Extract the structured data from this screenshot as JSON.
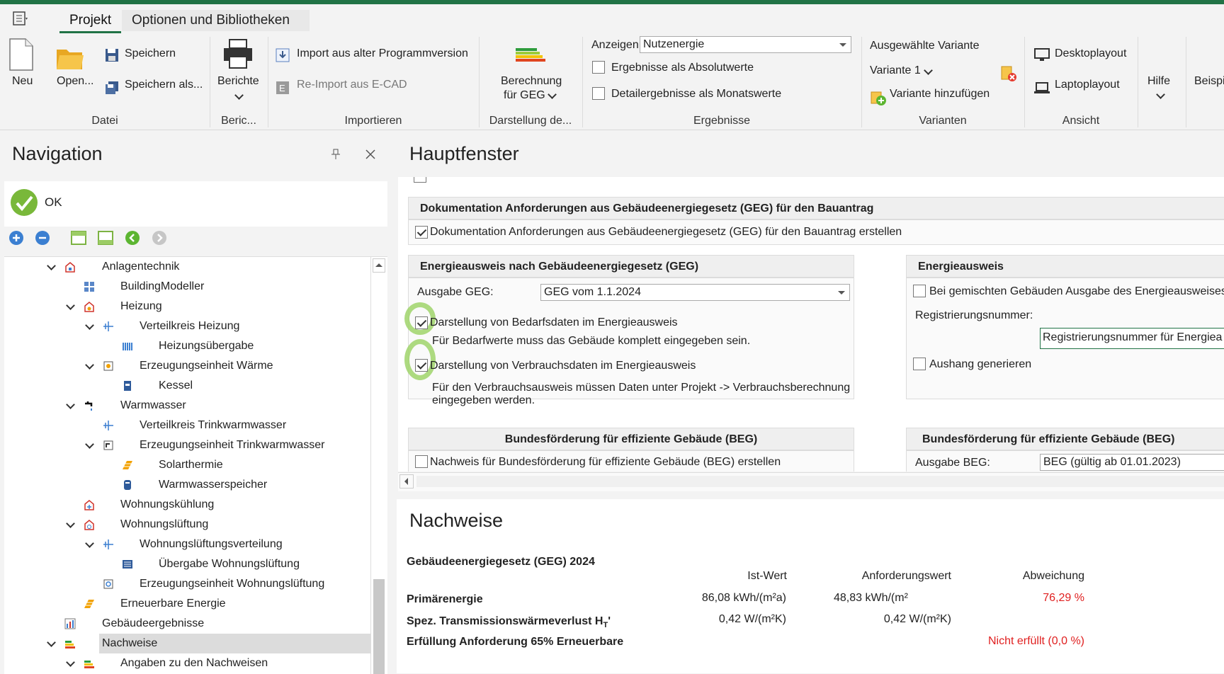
{
  "ribbon": {
    "tabs": [
      "Projekt",
      "Optionen und Bibliotheken"
    ],
    "datei": {
      "neu": "Neu",
      "open": "Open...",
      "speichern": "Speichern",
      "speichern_als": "Speichern als...",
      "group": "Datei"
    },
    "berichte": {
      "label": "Berichte",
      "group": "Beric..."
    },
    "importieren": {
      "import_alt": "Import aus alter Programmversion",
      "reimport": "Re-Import aus E-CAD",
      "group": "Importieren"
    },
    "darstellung": {
      "label1": "Berechnung",
      "label2": "für GEG",
      "group": "Darstellung de..."
    },
    "ergebnisse": {
      "anzeigen": "Anzeigen",
      "anzeigen_value": "Nutzenergie",
      "absolut": "Ergebnisse als Absolutwerte",
      "monats": "Detailergebnisse als Monatswerte",
      "group": "Ergebnisse"
    },
    "varianten": {
      "ausgewaehlt": "Ausgewählte Variante",
      "variante": "Variante 1",
      "hinzufuegen": "Variante hinzufügen",
      "group": "Varianten"
    },
    "ansicht": {
      "desktop": "Desktoplayout",
      "laptop": "Laptoplayout",
      "group": "Ansicht"
    },
    "hilfe": "Hilfe",
    "beispiel": "Beispi"
  },
  "navigation": {
    "title": "Navigation",
    "status": "OK",
    "tree": [
      {
        "label": "Anlagentechnik",
        "expanded": true
      },
      {
        "label": "BuildingModeller"
      },
      {
        "label": "Heizung",
        "expanded": true
      },
      {
        "label": "Verteilkreis Heizung",
        "expanded": true
      },
      {
        "label": "Heizungsübergabe"
      },
      {
        "label": "Erzeugungseinheit Wärme",
        "expanded": true
      },
      {
        "label": "Kessel"
      },
      {
        "label": "Warmwasser",
        "expanded": true
      },
      {
        "label": "Verteilkreis Trinkwarmwasser"
      },
      {
        "label": "Erzeugungseinheit Trinkwarmwasser",
        "expanded": true
      },
      {
        "label": "Solarthermie"
      },
      {
        "label": "Warmwasserspeicher"
      },
      {
        "label": "Wohnungskühlung"
      },
      {
        "label": "Wohnungslüftung",
        "expanded": true
      },
      {
        "label": "Wohnungslüftungsverteilung",
        "expanded": true
      },
      {
        "label": "Übergabe Wohnungslüftung"
      },
      {
        "label": "Erzeugungseinheit Wohnungslüftung"
      },
      {
        "label": "Erneuerbare Energie"
      },
      {
        "label": "Gebäudeergebnisse"
      },
      {
        "label": "Nachweise",
        "expanded": true,
        "selected": true
      },
      {
        "label": "Angaben zu den Nachweisen",
        "expanded": true
      }
    ]
  },
  "main": {
    "title": "Hauptfenster",
    "doku_head": "Dokumentation Anforderungen aus Gebäudeenergiegesetz (GEG) für den Bauantrag",
    "doku_check": "Dokumentation Anforderungen aus Gebäudeenergiegesetz (GEG) für den Bauantrag erstellen",
    "ea_geg_head": "Energieausweis nach Gebäudeenergiegesetz (GEG)",
    "ausgabe_geg": "Ausgabe GEG:",
    "ausgabe_geg_value": "GEG vom 1.1.2024",
    "bedarf_check": "Darstellung von Bedarfsdaten im Energieausweis",
    "bedarf_hint": "Für Bedarfwerte muss das Gebäude komplett eingegeben sein.",
    "verbrauch_check": "Darstellung von Verbrauchsdaten im Energieausweis",
    "verbrauch_hint1": "Für den Verbrauchsausweis müssen Daten unter Projekt -> Verbrauchsberechnung",
    "verbrauch_hint2": "eingegeben werden.",
    "ea_head": "Energieausweis",
    "gemischt_check": "Bei gemischten Gebäuden Ausgabe des Energieausweises f",
    "regnr_label": "Registrierungsnummer:",
    "regnr_placeholder": "Registrierungsnummer für Energiea",
    "aushang_check": "Aushang generieren",
    "beg_head_left": "Bundesförderung für effiziente Gebäude (BEG)",
    "beg_check": "Nachweis für Bundesförderung für effiziente Gebäude (BEG) erstellen",
    "beg_head_right": "Bundesförderung für effiziente Gebäude (BEG)",
    "ausgabe_beg": "Ausgabe BEG:",
    "ausgabe_beg_value": "BEG (gültig ab 01.01.2023)"
  },
  "nachweise": {
    "title": "Nachweise",
    "subtitle": "Gebäudeenergiegesetz (GEG) 2024",
    "col_ist": "Ist-Wert",
    "col_anf": "Anforderungswert",
    "col_abw": "Abweichung",
    "rows": [
      {
        "label": "Primärenergie",
        "ist": "86,08 kWh/(m²a)",
        "anf": "48,83 kWh/(m²",
        "abw": "76,29 %"
      },
      {
        "label": "Spez. Transmissionswärmeverlust H",
        "sub": "T",
        "suffix": "'",
        "ist": "0,42 W/(m²K)",
        "anf": "0,42 W/(m²K)",
        "abw": ""
      },
      {
        "label": "Erfüllung Anforderung 65% Erneuerbare",
        "ist": "",
        "anf": "",
        "abw": "Nicht erfüllt (0,0 %)"
      }
    ]
  },
  "colors": {
    "accent": "#217346",
    "error": "#e02020",
    "highlight": "#9fd36a"
  }
}
